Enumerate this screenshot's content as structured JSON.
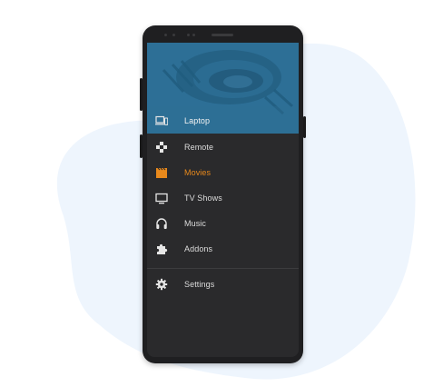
{
  "drawer": {
    "host": {
      "label": "Laptop",
      "icon": "laptop-phone-icon"
    },
    "items": [
      {
        "label": "Remote",
        "icon": "gamepad-icon",
        "active": false
      },
      {
        "label": "Movies",
        "icon": "clapperboard-icon",
        "active": true
      },
      {
        "label": "TV Shows",
        "icon": "tv-icon",
        "active": false
      },
      {
        "label": "Music",
        "icon": "headphones-icon",
        "active": false
      },
      {
        "label": "Addons",
        "icon": "puzzle-icon",
        "active": false
      }
    ],
    "settings": {
      "label": "Settings",
      "icon": "gear-icon"
    }
  },
  "colors": {
    "accent": "#e8891c",
    "header": "#2d6f96",
    "drawer_bg": "#2a2a2c",
    "text": "#dcdcdc",
    "backdrop_blob": "#eef5fd"
  }
}
